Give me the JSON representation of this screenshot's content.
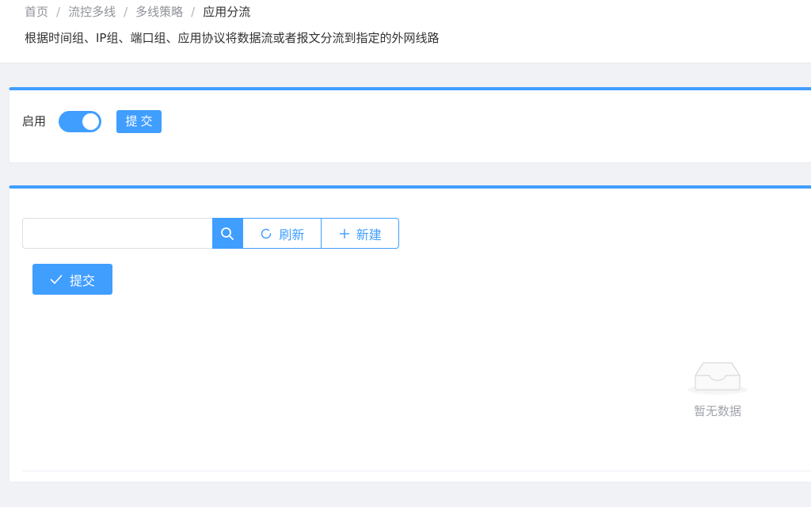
{
  "breadcrumb": {
    "items": [
      "首页",
      "流控多线",
      "多线策略",
      "应用分流"
    ],
    "separator": "/"
  },
  "page": {
    "description": "根据时间组、IP组、端口组、应用协议将数据流或者报文分流到指定的外网线路"
  },
  "settings": {
    "enable_label": "启用",
    "enabled": true,
    "submit_label": "提交"
  },
  "toolbar": {
    "search_value": "",
    "search_placeholder": "",
    "refresh_label": "刷新",
    "new_label": "新建",
    "submit_label": "提交"
  },
  "table": {
    "empty_text": "暂无数据"
  },
  "colors": {
    "primary": "#409eff",
    "background": "#f0f2f5"
  }
}
